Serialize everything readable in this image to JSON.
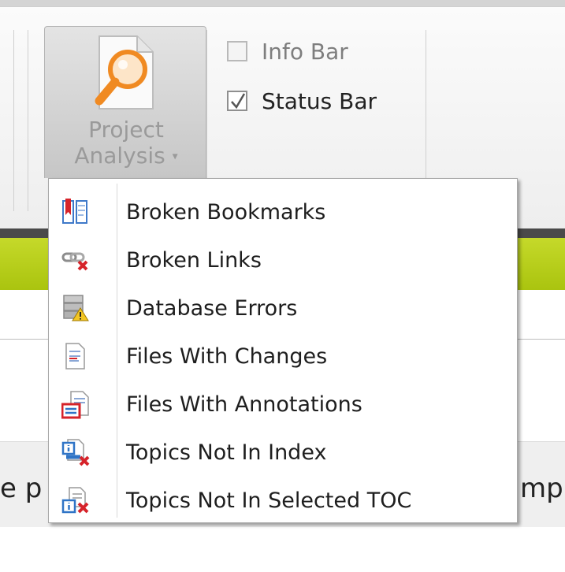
{
  "ribbon": {
    "project_analysis": {
      "line1": "Project",
      "line2": "Analysis",
      "caret": "▾",
      "icon": "project-analysis-magnifier-icon"
    },
    "checkboxes": [
      {
        "label": "Info Bar",
        "checked": false
      },
      {
        "label": "Status Bar",
        "checked": true
      }
    ]
  },
  "background": {
    "left_fragment": "e p",
    "right_fragment": "mp"
  },
  "menu": {
    "items": [
      {
        "label": "Broken Bookmarks",
        "icon": "broken-bookmarks-icon"
      },
      {
        "label": "Broken Links",
        "icon": "broken-links-icon"
      },
      {
        "label": "Database Errors",
        "icon": "database-errors-icon"
      },
      {
        "label": "Files With Changes",
        "icon": "files-with-changes-icon"
      },
      {
        "label": "Files With Annotations",
        "icon": "files-with-annotations-icon"
      },
      {
        "label": "Topics Not In Index",
        "icon": "topics-not-in-index-icon"
      },
      {
        "label": "Topics Not In Selected TOC",
        "icon": "topics-not-in-toc-icon"
      }
    ]
  },
  "colors": {
    "accent_orange": "#f08a22",
    "green_bar": "#b4cc17",
    "error_red": "#d6232a",
    "info_blue": "#2f74c6"
  }
}
